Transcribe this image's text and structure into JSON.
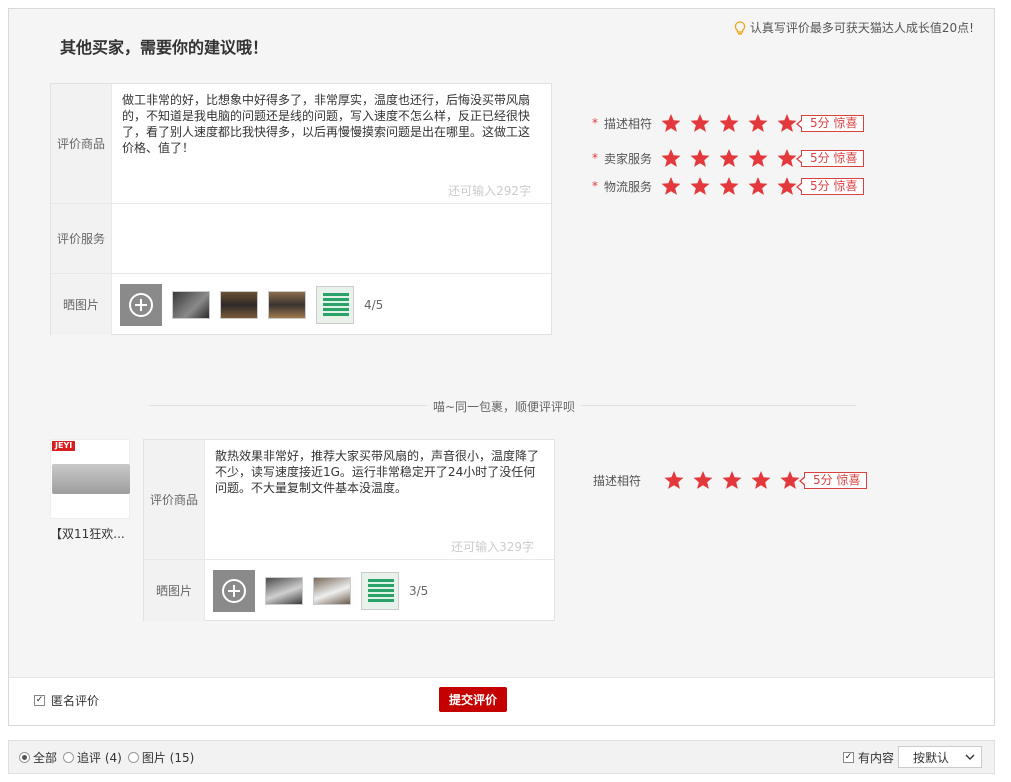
{
  "header": {
    "title": "其他买家，需要你的建议哦！",
    "tip": "认真写评价最多可获天猫达人成长值20点!"
  },
  "review1": {
    "product_label": "评价商品",
    "text": "做工非常的好，比想象中好得多了，非常厚实，温度也还行，后悔没买带风扇的，不知道是我电脑的问题还是线的问题，写入速度不怎么样，反正已经很快了，看了别人速度都比我快得多，以后再慢慢摸索问题是出在哪里。这做工这价格、值了！",
    "counter": "还可输入292字",
    "service_label": "评价服务",
    "photos_label": "晒图片",
    "photo_count": "4/5"
  },
  "ratings1": [
    {
      "label": "描述相符",
      "badge": "5分 惊喜",
      "score": 5
    },
    {
      "label": "卖家服务",
      "badge": "5分 惊喜",
      "score": 5
    },
    {
      "label": "物流服务",
      "badge": "5分 惊喜",
      "score": 5
    }
  ],
  "divider": "喵~同一包裹，顺便评评呗",
  "product2": {
    "brand": "JEYI",
    "name": "【双11狂欢..."
  },
  "review2": {
    "product_label": "评价商品",
    "text": "散热效果非常好，推荐大家买带风扇的，声音很小，温度降了不少，读写速度接近1G。运行非常稳定开了24小时了没任何问题。不大量复制文件基本没温度。",
    "counter": "还可输入329字",
    "photos_label": "晒图片",
    "photo_count": "3/5"
  },
  "ratings2": [
    {
      "label": "描述相符",
      "badge": "5分 惊喜",
      "score": 5
    }
  ],
  "footer": {
    "anonymous": "匿名评价",
    "submit": "提交评价"
  },
  "filter": {
    "all": "全部",
    "followup": "追评 (4)",
    "images": "图片 (15)",
    "has_content": "有内容",
    "sort": "按默认"
  },
  "colors": {
    "accent": "#c40000",
    "star": "#e4393c"
  }
}
